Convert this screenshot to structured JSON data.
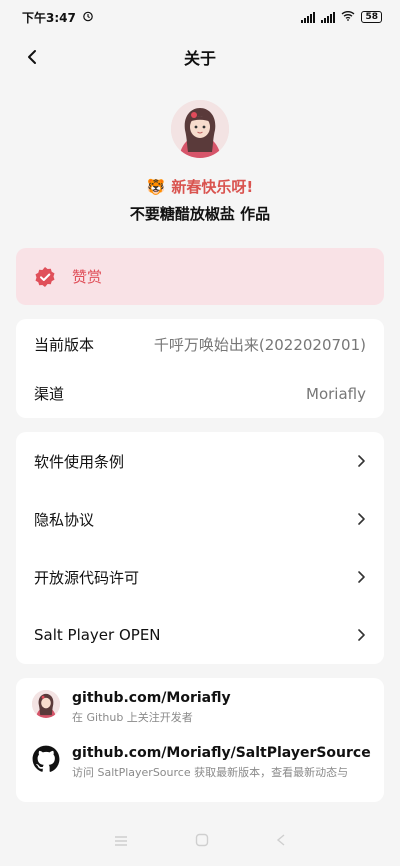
{
  "status": {
    "time": "下午3:47",
    "battery": "58"
  },
  "header": {
    "title": "关于"
  },
  "profile": {
    "greeting": "新春快乐呀!",
    "greeting_emoji": "🐯",
    "author": "不要糖醋放椒盐 作品"
  },
  "donate": {
    "label": "赞赏"
  },
  "info": {
    "version_label": "当前版本",
    "version_value": "千呼万唤始出来(2022020701)",
    "channel_label": "渠道",
    "channel_value": "Moriafly"
  },
  "menu": {
    "items": [
      {
        "label": "软件使用条例"
      },
      {
        "label": "隐私协议"
      },
      {
        "label": "开放源代码许可"
      },
      {
        "label": "Salt Player OPEN"
      }
    ]
  },
  "links": [
    {
      "title": "github.com/Moriafly",
      "desc": "在 Github 上关注开发者"
    },
    {
      "title": "github.com/Moriafly/SaltPlayerSource",
      "desc": "访问 SaltPlayerSource 获取最新版本，查看最新动态与"
    }
  ],
  "colors": {
    "accent_red": "#e0505a",
    "donate_bg": "#f9e2e6",
    "page_bg": "#f5f5f5"
  }
}
